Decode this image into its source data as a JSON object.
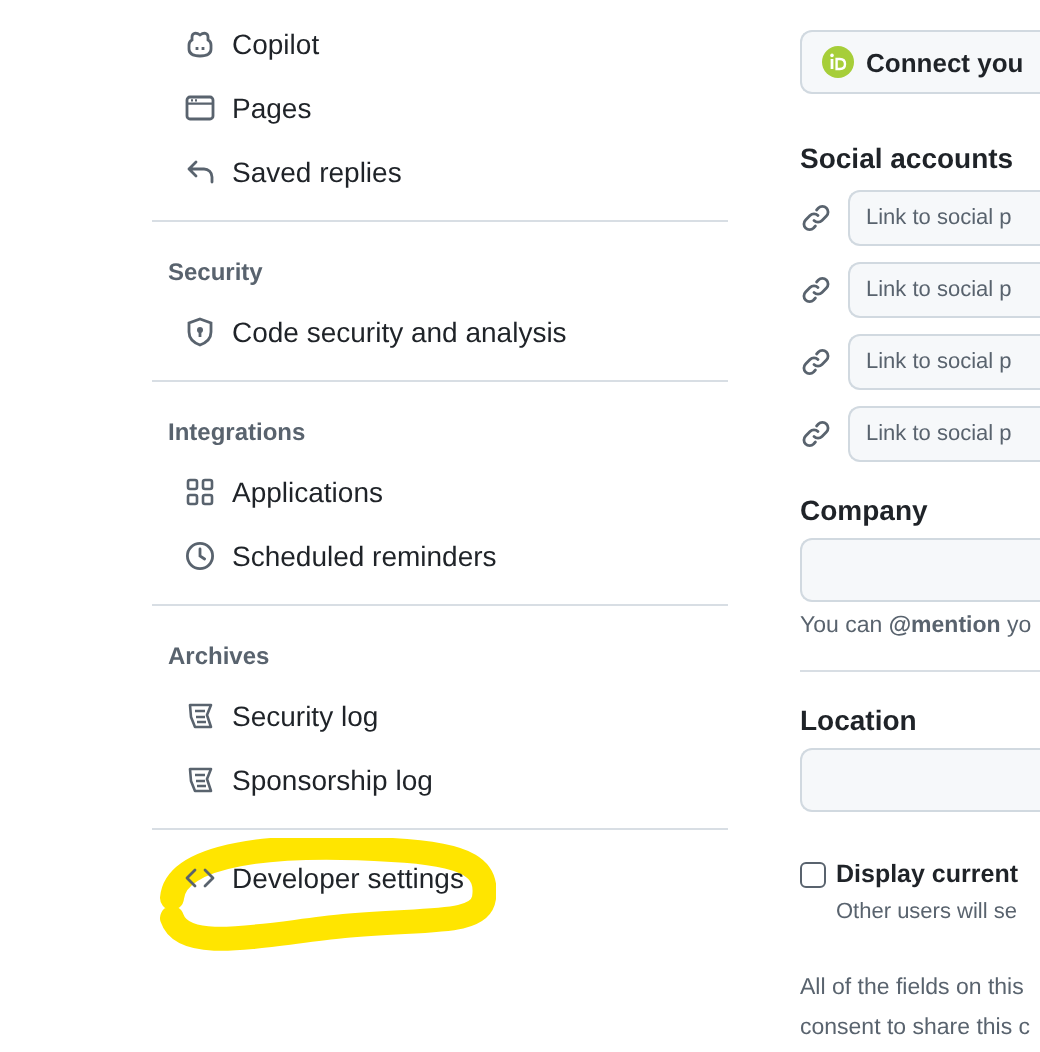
{
  "sidebar": {
    "groups": [
      {
        "items": [
          {
            "label": "Copilot",
            "kind": "copilot"
          },
          {
            "label": "Pages",
            "kind": "browser"
          },
          {
            "label": "Saved replies",
            "kind": "reply"
          }
        ]
      },
      {
        "heading": "Security",
        "items": [
          {
            "label": "Code security and analysis",
            "kind": "shield"
          }
        ]
      },
      {
        "heading": "Integrations",
        "items": [
          {
            "label": "Applications",
            "kind": "apps"
          },
          {
            "label": "Scheduled reminders",
            "kind": "clock"
          }
        ]
      },
      {
        "heading": "Archives",
        "items": [
          {
            "label": "Security log",
            "kind": "log"
          },
          {
            "label": "Sponsorship log",
            "kind": "log"
          }
        ]
      },
      {
        "items": [
          {
            "label": "Developer settings",
            "kind": "code",
            "highlighted": true
          }
        ]
      }
    ]
  },
  "profile": {
    "orcid_button": {
      "label": "Connect you"
    },
    "social_accounts": {
      "title": "Social accounts",
      "links": [
        {
          "placeholder": "Link to social p"
        },
        {
          "placeholder": "Link to social p"
        },
        {
          "placeholder": "Link to social p"
        },
        {
          "placeholder": "Link to social p"
        }
      ]
    },
    "company": {
      "label": "Company",
      "note": "You can **@mention** yo"
    },
    "location": {
      "label": "Location"
    },
    "display_time": {
      "label": "Display current",
      "checked": false,
      "note": "Other users will se"
    },
    "footer_lines": [
      "All of the fields on this",
      "consent to share this c"
    ]
  }
}
